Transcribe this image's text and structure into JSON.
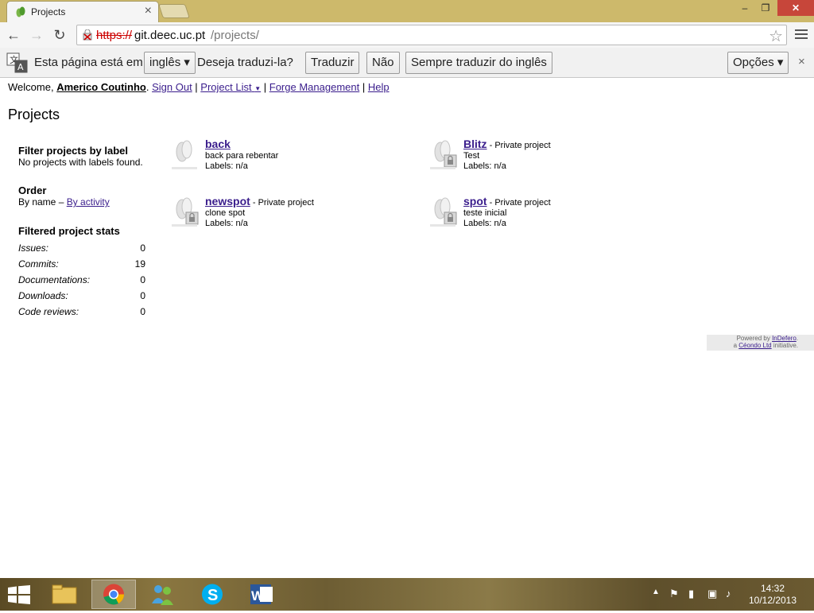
{
  "browser": {
    "tab_title": "Projects",
    "tab_close": "×",
    "url_protocol": "https://",
    "url_host": "git.deec.uc.pt",
    "url_path": "/projects/",
    "window_min": "–",
    "window_max": "❐",
    "window_close": "✕"
  },
  "translate": {
    "prefix": "Esta página está em",
    "language": "inglês",
    "question": "Deseja traduzi-la?",
    "translate_button": "Traduzir",
    "no_button": "Não",
    "always_button": "Sempre traduzir do inglês",
    "options_button": "Opções",
    "close": "×"
  },
  "userbar": {
    "welcome": "Welcome,",
    "username": "Americo Coutinho",
    "sign_out": "Sign Out",
    "project_list": "Project List",
    "forge_management": "Forge Management",
    "help": "Help"
  },
  "page_title": "Projects",
  "sidebar": {
    "filter_heading": "Filter projects by label",
    "filter_text": "No projects with labels found.",
    "order_heading": "Order",
    "order_by_name": "By name –",
    "order_by_activity": "By activity",
    "stats_heading": "Filtered project stats",
    "stats": [
      {
        "label": "Issues:",
        "value": "0"
      },
      {
        "label": "Commits:",
        "value": "19"
      },
      {
        "label": "Documentations:",
        "value": "0"
      },
      {
        "label": "Downloads:",
        "value": "0"
      },
      {
        "label": "Code reviews:",
        "value": "0"
      }
    ]
  },
  "projects": [
    {
      "name": "back",
      "private": "",
      "description": "back para rebentar",
      "labels": "Labels: n/a"
    },
    {
      "name": "Blitz",
      "private": "- Private project",
      "description": "Test",
      "labels": "Labels: n/a"
    },
    {
      "name": "newspot",
      "private": "- Private project",
      "description": "clone spot",
      "labels": "Labels: n/a"
    },
    {
      "name": "spot",
      "private": "- Private project",
      "description": "teste inicial",
      "labels": "Labels: n/a"
    }
  ],
  "footer": {
    "powered_by": "Powered by",
    "indefero": "InDefero",
    "a": "a",
    "ceondo": "Céondo Ltd",
    "initiative": "initiative."
  },
  "taskbar": {
    "time": "14:32",
    "date": "10/12/2013"
  },
  "colors": {
    "link": "#3a1d8c",
    "titlebar": "#cdb96b",
    "close_button": "#c7463a"
  }
}
